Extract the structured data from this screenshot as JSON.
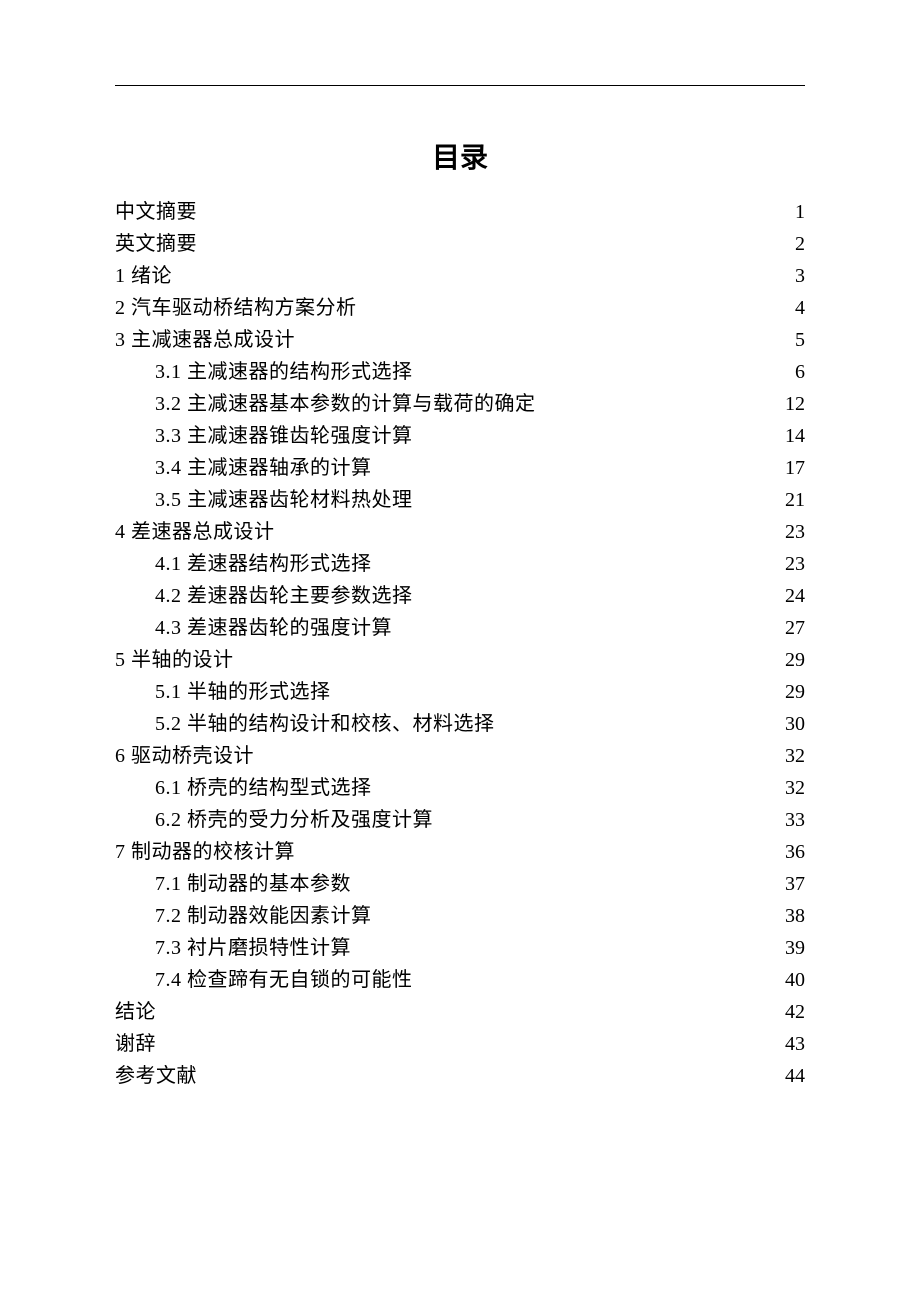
{
  "title": "目录",
  "entries": [
    {
      "text": "中文摘要",
      "page": "1",
      "indent": 0
    },
    {
      "text": "英文摘要",
      "page": "2",
      "indent": 0
    },
    {
      "text": "1 绪论",
      "page": "3",
      "indent": 0
    },
    {
      "text": "2 汽车驱动桥结构方案分析",
      "page": "4",
      "indent": 0
    },
    {
      "text": "3 主减速器总成设计",
      "page": "5",
      "indent": 0
    },
    {
      "text": "3.1 主减速器的结构形式选择",
      "page": "6",
      "indent": 1
    },
    {
      "text": "3.2 主减速器基本参数的计算与载荷的确定",
      "page": "12",
      "indent": 1
    },
    {
      "text": "3.3 主减速器锥齿轮强度计算",
      "page": "14",
      "indent": 1
    },
    {
      "text": "3.4 主减速器轴承的计算",
      "page": "17",
      "indent": 1
    },
    {
      "text": "3.5 主减速器齿轮材料热处理",
      "page": "21",
      "indent": 1
    },
    {
      "text": "4 差速器总成设计",
      "page": "23",
      "indent": 0
    },
    {
      "text": "4.1 差速器结构形式选择",
      "page": "23",
      "indent": 1
    },
    {
      "text": "4.2 差速器齿轮主要参数选择",
      "page": "24",
      "indent": 1
    },
    {
      "text": "4.3 差速器齿轮的强度计算",
      "page": "27",
      "indent": 1
    },
    {
      "text": "5 半轴的设计",
      "page": "29",
      "indent": 0
    },
    {
      "text": "5.1 半轴的形式选择",
      "page": "29",
      "indent": 1
    },
    {
      "text": "5.2 半轴的结构设计和校核、材料选择",
      "page": "30",
      "indent": 1
    },
    {
      "text": "6 驱动桥壳设计",
      "page": "32",
      "indent": 0
    },
    {
      "text": "6.1 桥壳的结构型式选择",
      "page": "32",
      "indent": 1
    },
    {
      "text": "6.2 桥壳的受力分析及强度计算",
      "page": "33",
      "indent": 1
    },
    {
      "text": "7 制动器的校核计算",
      "page": "36",
      "indent": 0
    },
    {
      "text": "7.1 制动器的基本参数",
      "page": "37",
      "indent": 1
    },
    {
      "text": "7.2 制动器效能因素计算",
      "page": "38",
      "indent": 1
    },
    {
      "text": "7.3 衬片磨损特性计算",
      "page": "39",
      "indent": 1
    },
    {
      "text": "7.4 检查蹄有无自锁的可能性",
      "page": "40",
      "indent": 1
    },
    {
      "text": "结论",
      "page": "42",
      "indent": 0
    },
    {
      "text": "谢辞",
      "page": "43",
      "indent": 0
    },
    {
      "text": "参考文献",
      "page": "44",
      "indent": 0
    }
  ]
}
